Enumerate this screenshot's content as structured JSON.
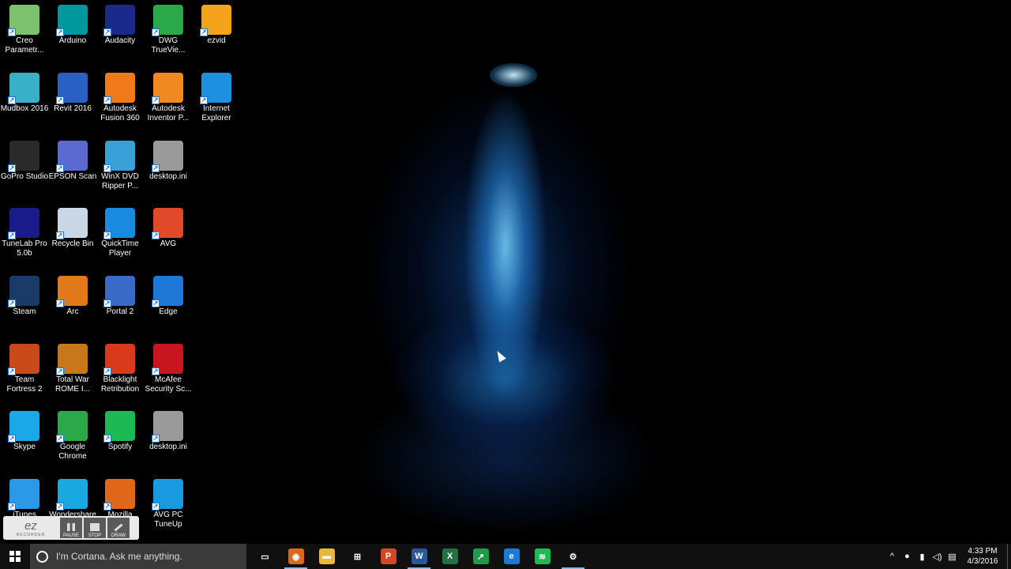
{
  "desktop": {
    "icons": [
      {
        "label": "Creo\nParametr...",
        "icon": "creo-icon",
        "color": "#7cc16e"
      },
      {
        "label": "Arduino",
        "icon": "arduino-icon",
        "color": "#00979d"
      },
      {
        "label": "Audacity",
        "icon": "audacity-icon",
        "color": "#1a2a8a"
      },
      {
        "label": "DWG\nTrueVie...",
        "icon": "dwg-trueview-icon",
        "color": "#2aa84a"
      },
      {
        "label": "ezvid",
        "icon": "ezvid-icon",
        "color": "#f5a31a"
      },
      {
        "label": "Mudbox 2016",
        "icon": "mudbox-icon",
        "color": "#3ab0c8"
      },
      {
        "label": "Revit 2016",
        "icon": "revit-icon",
        "color": "#2a5fc4"
      },
      {
        "label": "Autodesk\nFusion 360",
        "icon": "fusion360-icon",
        "color": "#f07a1a"
      },
      {
        "label": "Autodesk\nInventor P...",
        "icon": "inventor-icon",
        "color": "#f08a20"
      },
      {
        "label": "Internet\nExplorer",
        "icon": "internet-explorer-icon",
        "color": "#1e90e0"
      },
      {
        "label": "GoPro Studio",
        "icon": "gopro-icon",
        "color": "#2a2a2a"
      },
      {
        "label": "EPSON Scan",
        "icon": "epson-scan-icon",
        "color": "#5a6ad0"
      },
      {
        "label": "WinX DVD\nRipper P...",
        "icon": "winx-dvd-icon",
        "color": "#3aa0d8"
      },
      {
        "label": "desktop.ini",
        "icon": "settings-file-icon",
        "color": "#9a9a9a"
      },
      {
        "label": "TuneLab Pro\n5.0b",
        "icon": "tunelab-icon",
        "color": "#1a1a8a"
      },
      {
        "label": "Recycle Bin",
        "icon": "recycle-bin-icon",
        "color": "#c8d8e8"
      },
      {
        "label": "QuickTime\nPlayer",
        "icon": "quicktime-icon",
        "color": "#1a8ae0"
      },
      {
        "label": "AVG",
        "icon": "avg-icon",
        "color": "#e04a2a"
      },
      {
        "label": "Steam",
        "icon": "steam-icon",
        "color": "#1a3a6a"
      },
      {
        "label": "Arc",
        "icon": "arc-icon",
        "color": "#e07a1a"
      },
      {
        "label": "Portal 2",
        "icon": "portal2-icon",
        "color": "#3a6ac8"
      },
      {
        "label": "Edge",
        "icon": "edge-icon",
        "color": "#1e78d8"
      },
      {
        "label": "Team\nFortress 2",
        "icon": "tf2-icon",
        "color": "#c84a1a"
      },
      {
        "label": "Total War\nROME I...",
        "icon": "total-war-icon",
        "color": "#c8781a"
      },
      {
        "label": "Blacklight\nRetribution",
        "icon": "blacklight-icon",
        "color": "#d83a1a"
      },
      {
        "label": "McAfee\nSecurity Sc...",
        "icon": "mcafee-icon",
        "color": "#c8161e"
      },
      {
        "label": "Skype",
        "icon": "skype-icon",
        "color": "#1aa8e8"
      },
      {
        "label": "Google\nChrome",
        "icon": "chrome-icon",
        "color": "#2aa84a"
      },
      {
        "label": "Spotify",
        "icon": "spotify-icon",
        "color": "#1db954"
      },
      {
        "label": "desktop.ini",
        "icon": "settings-file-icon",
        "color": "#9a9a9a"
      },
      {
        "label": "iTunes",
        "icon": "itunes-icon",
        "color": "#2a9ae8"
      },
      {
        "label": "Wondershare",
        "icon": "wondershare-icon",
        "color": "#1aa8e0"
      },
      {
        "label": "Mozilla",
        "icon": "firefox-icon",
        "color": "#e0661a"
      },
      {
        "label": "AVG PC\nTuneUp",
        "icon": "avg-tuneup-icon",
        "color": "#1a9ae0"
      }
    ]
  },
  "recorder": {
    "logo": "ez",
    "sublabel": "RECORDER",
    "buttons": [
      "PAUSE",
      "STOP",
      "DRAW"
    ]
  },
  "taskbar": {
    "cortana_placeholder": "I'm Cortana. Ask me anything.",
    "apps": [
      {
        "icon": "task-view-icon",
        "color": "#101010",
        "glyph": "▭",
        "active": false
      },
      {
        "icon": "firefox-icon",
        "color": "#e0661a",
        "glyph": "◉",
        "active": true
      },
      {
        "icon": "file-explorer-icon",
        "color": "#e8b83a",
        "glyph": "▬",
        "active": false
      },
      {
        "icon": "store-icon",
        "color": "#101010",
        "glyph": "⊞",
        "active": false
      },
      {
        "icon": "powerpoint-icon",
        "color": "#d24726",
        "glyph": "P",
        "active": false
      },
      {
        "icon": "word-icon",
        "color": "#2b579a",
        "glyph": "W",
        "active": true
      },
      {
        "icon": "excel-icon",
        "color": "#217346",
        "glyph": "X",
        "active": false
      },
      {
        "icon": "stock-chart-icon",
        "color": "#1e9a4a",
        "glyph": "↗",
        "active": false
      },
      {
        "icon": "edge-icon",
        "color": "#1e78d8",
        "glyph": "e",
        "active": false
      },
      {
        "icon": "spotify-icon",
        "color": "#1db954",
        "glyph": "≋",
        "active": false
      },
      {
        "icon": "settings-icon",
        "color": "#101010",
        "glyph": "⚙",
        "active": true
      }
    ],
    "tray": {
      "icons": [
        {
          "icon": "chevron-up-icon",
          "glyph": "^"
        },
        {
          "icon": "shield-icon",
          "glyph": "●"
        },
        {
          "icon": "battery-icon",
          "glyph": "▮"
        },
        {
          "icon": "volume-icon",
          "glyph": "◁)"
        },
        {
          "icon": "notification-icon",
          "glyph": "▤"
        }
      ],
      "time": "4:33 PM",
      "date": "4/3/2016"
    }
  }
}
